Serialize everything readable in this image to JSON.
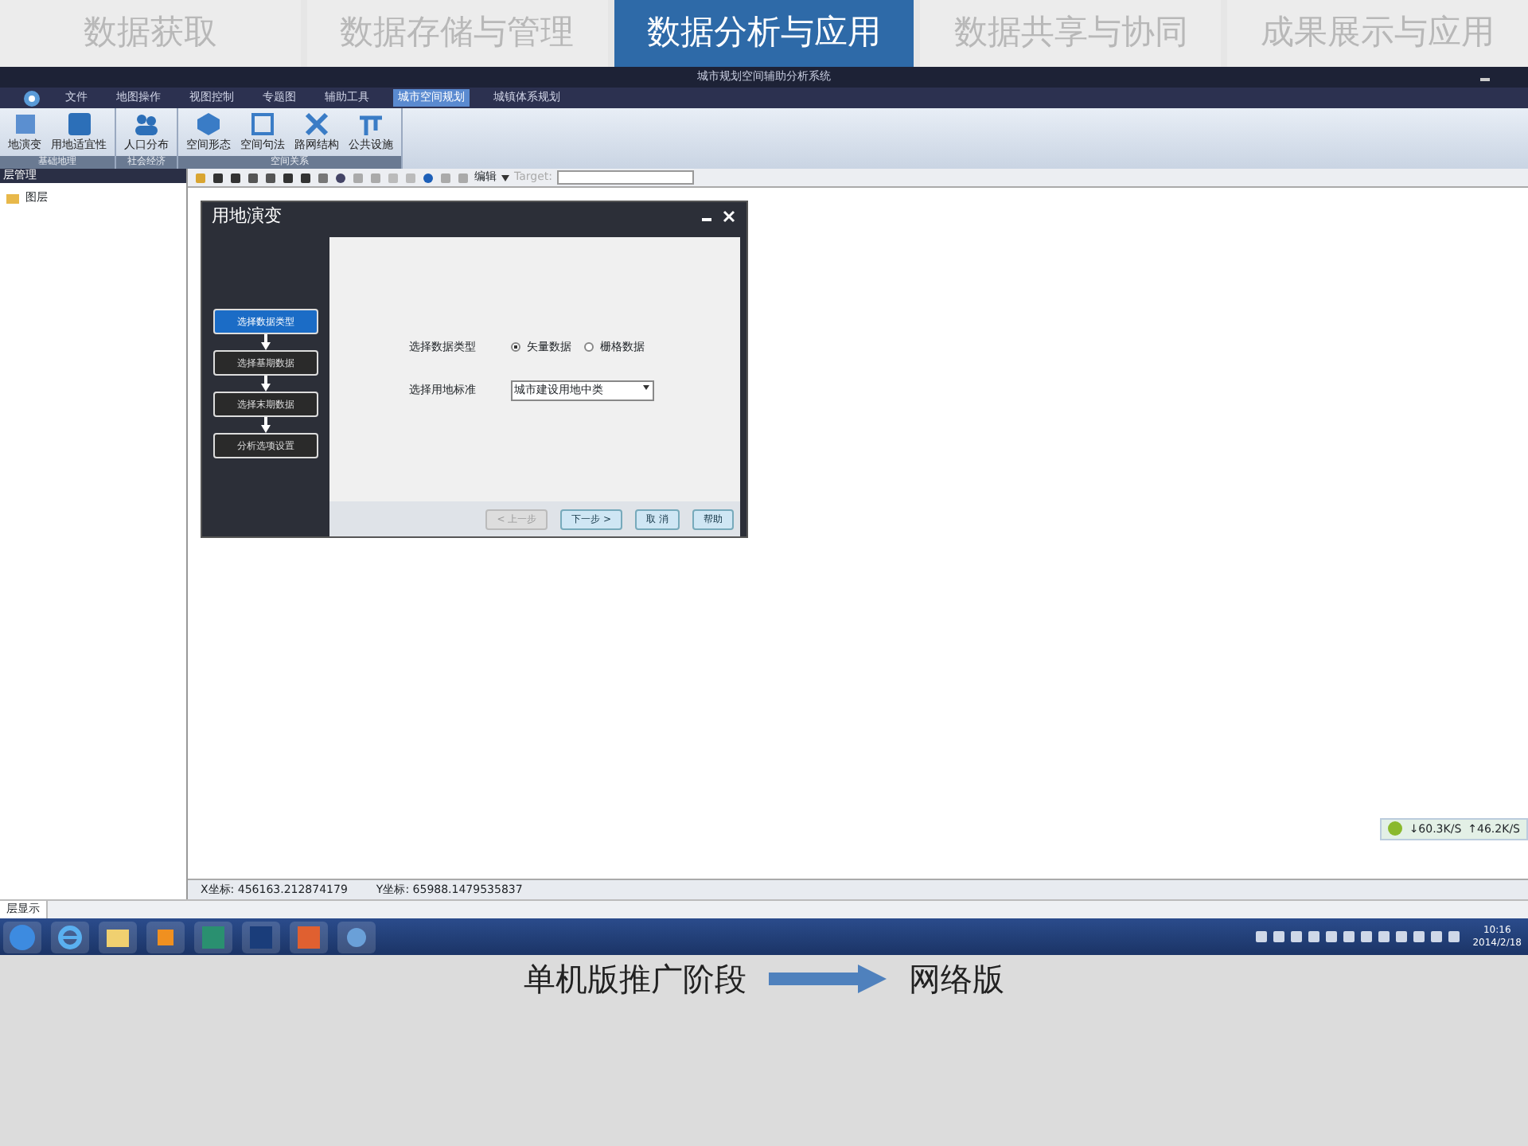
{
  "slide_tabs": [
    {
      "label": "数据获取",
      "selected": false
    },
    {
      "label": "数据存储与管理",
      "selected": false
    },
    {
      "label": "数据分析与应用",
      "selected": true
    },
    {
      "label": "数据共享与协同",
      "selected": false
    },
    {
      "label": "成果展示与应用",
      "selected": false
    }
  ],
  "app": {
    "title": "城市规划空间辅助分析系统",
    "menu": [
      {
        "label": "文件",
        "selected": false
      },
      {
        "label": "地图操作",
        "selected": false
      },
      {
        "label": "视图控制",
        "selected": false
      },
      {
        "label": "专题图",
        "selected": false
      },
      {
        "label": "辅助工具",
        "selected": false
      },
      {
        "label": "城市空间规划",
        "selected": true
      },
      {
        "label": "城镇体系规划",
        "selected": false
      }
    ],
    "ribbon_groups": [
      {
        "label": "基础地理",
        "buttons": [
          "地演变",
          "用地适宜性"
        ]
      },
      {
        "label": "社会经济",
        "buttons": [
          "人口分布"
        ]
      },
      {
        "label": "空间关系",
        "buttons": [
          "空间形态",
          "空间句法",
          "路网结构",
          "公共设施"
        ]
      }
    ],
    "left_panel": {
      "title": "层管理",
      "tree": [
        {
          "label": "图层"
        }
      ]
    },
    "toolbar": {
      "edit_menu": "编辑",
      "target_label": "Target:"
    },
    "dialog": {
      "title": "用地演变",
      "steps": [
        {
          "label": "选择数据类型",
          "selected": true
        },
        {
          "label": "选择基期数据",
          "selected": false
        },
        {
          "label": "选择末期数据",
          "selected": false
        },
        {
          "label": "分析选项设置",
          "selected": false
        }
      ],
      "data_type_label": "选择数据类型",
      "radios": [
        {
          "label": "矢量数据",
          "checked": true
        },
        {
          "label": "栅格数据",
          "checked": false
        }
      ],
      "standard_label": "选择用地标准",
      "standard_value": "城市建设用地中类",
      "buttons": [
        {
          "label": "< 上一步",
          "disabled": true
        },
        {
          "label": "下一步 >",
          "disabled": false
        },
        {
          "label": "取 消",
          "disabled": false
        },
        {
          "label": "帮助",
          "disabled": false
        }
      ]
    },
    "speed": {
      "down": "↓60.3K/S",
      "up": "↑46.2K/S"
    },
    "status_bar": {
      "x": "X坐标:  456163.212874179",
      "y": "Y坐标:  65988.1479535837"
    },
    "bottom_tab": "层显示",
    "clock": {
      "time": "10:16",
      "date": "2014/2/18"
    }
  },
  "caption": {
    "left": "单机版推广阶段",
    "right": "网络版"
  }
}
